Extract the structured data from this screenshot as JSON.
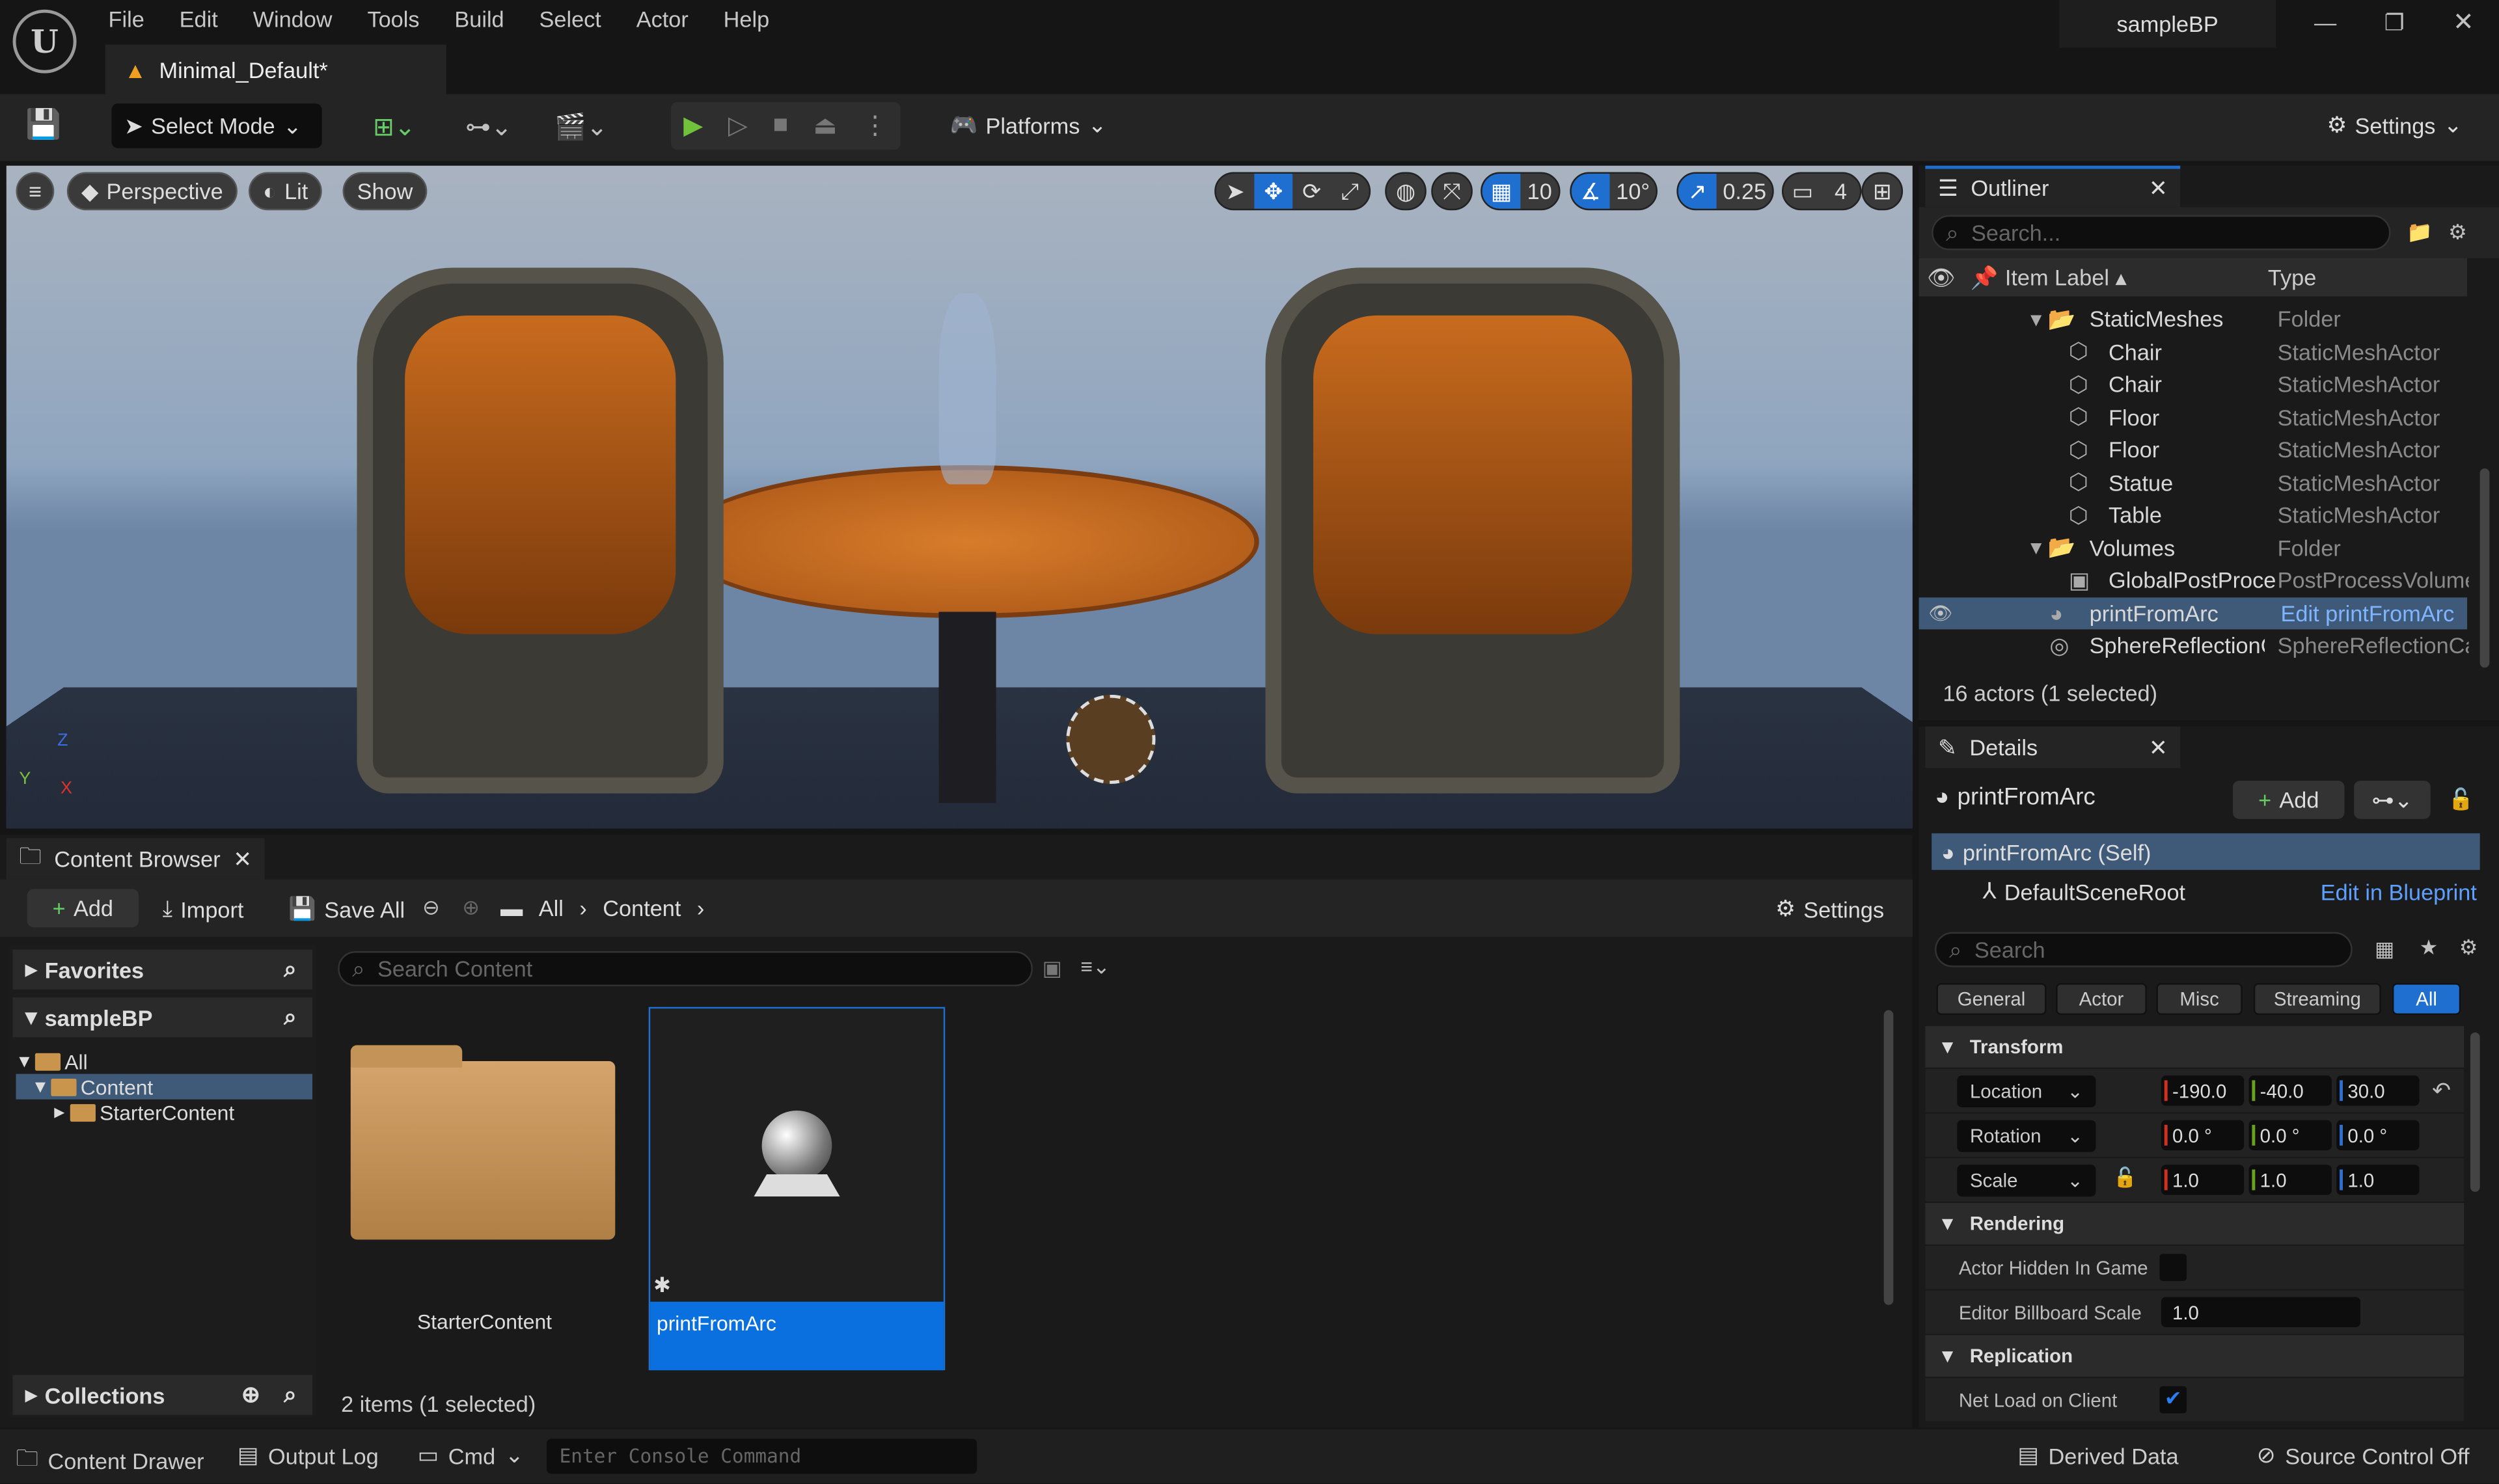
{
  "menu": [
    "File",
    "Edit",
    "Window",
    "Tools",
    "Build",
    "Select",
    "Actor",
    "Help"
  ],
  "project": "sampleBP",
  "level_tab": "Minimal_Default*",
  "toolbar": {
    "select_mode": "Select Mode",
    "platforms": "Platforms",
    "settings": "Settings"
  },
  "viewport": {
    "perspective": "Perspective",
    "lit": "Lit",
    "show": "Show",
    "grid_snap": "10",
    "rot_snap": "10°",
    "scale_snap": "0.25",
    "camera_speed": "4",
    "active_tool": "translate",
    "axes": [
      "Z",
      "Y",
      "X"
    ]
  },
  "outliner": {
    "title": "Outliner",
    "search_placeholder": "Search...",
    "col_label": "Item Label",
    "col_type": "Type",
    "rows": [
      {
        "label": "StaticMeshes",
        "type": "Folder",
        "icon": "folder-icon",
        "indent": 0
      },
      {
        "label": "Chair",
        "type": "StaticMeshActor",
        "icon": "static-mesh-icon",
        "indent": 1
      },
      {
        "label": "Chair",
        "type": "StaticMeshActor",
        "icon": "static-mesh-icon",
        "indent": 1
      },
      {
        "label": "Floor",
        "type": "StaticMeshActor",
        "icon": "static-mesh-icon",
        "indent": 1
      },
      {
        "label": "Floor",
        "type": "StaticMeshActor",
        "icon": "static-mesh-icon",
        "indent": 1
      },
      {
        "label": "Statue",
        "type": "StaticMeshActor",
        "icon": "static-mesh-icon",
        "indent": 1
      },
      {
        "label": "Table",
        "type": "StaticMeshActor",
        "icon": "static-mesh-icon",
        "indent": 1
      },
      {
        "label": "Volumes",
        "type": "Folder",
        "icon": "folder-icon",
        "indent": 0
      },
      {
        "label": "GlobalPostProce",
        "type": "PostProcessVolume",
        "icon": "post-process-icon",
        "indent": 1
      },
      {
        "label": "printFromArc",
        "type": "Edit printFromArc",
        "icon": "actor-icon",
        "indent": 0,
        "selected": true
      },
      {
        "label": "SphereReflectionC",
        "type": "SphereReflectionCa",
        "icon": "sphere-reflection-icon",
        "indent": 0
      }
    ],
    "status": "16 actors (1 selected)"
  },
  "details": {
    "title": "Details",
    "actor": "printFromArc",
    "add": "Add",
    "self": "printFromArc (Self)",
    "root": "DefaultSceneRoot",
    "edit_bp": "Edit in Blueprint",
    "search_placeholder": "Search",
    "filters": [
      "General",
      "Actor",
      "Misc",
      "Streaming",
      "All"
    ],
    "active_filter": "All",
    "transform": {
      "title": "Transform",
      "location_label": "Location",
      "rotation_label": "Rotation",
      "scale_label": "Scale",
      "location": [
        "-190.0",
        "-40.0",
        "30.0"
      ],
      "rotation": [
        "0.0 °",
        "0.0 °",
        "0.0 °"
      ],
      "scale": [
        "1.0",
        "1.0",
        "1.0"
      ]
    },
    "rendering": {
      "title": "Rendering",
      "hidden_label": "Actor Hidden In Game",
      "hidden": false,
      "billboard_label": "Editor Billboard Scale",
      "billboard": "1.0"
    },
    "replication": {
      "title": "Replication",
      "net_load_label": "Net Load on Client",
      "net_load": true
    }
  },
  "content_browser": {
    "title": "Content Browser",
    "add": "Add",
    "import": "Import",
    "save_all": "Save All",
    "path": [
      "All",
      "Content"
    ],
    "settings": "Settings",
    "favorites": "Favorites",
    "project": "sampleBP",
    "tree": [
      "All",
      "Content",
      "StarterContent"
    ],
    "collections": "Collections",
    "search_placeholder": "Search Content",
    "assets": [
      {
        "name": "StarterContent",
        "kind": "folder"
      },
      {
        "name": "printFromArc",
        "kind": "blueprint",
        "selected": true
      }
    ],
    "status": "2 items (1 selected)"
  },
  "statusbar": {
    "content_drawer": "Content Drawer",
    "output_log": "Output Log",
    "cmd": "Cmd",
    "console_placeholder": "Enter Console Command",
    "derived_data": "Derived Data",
    "source_control": "Source Control Off"
  },
  "colors": {
    "accent": "#1f6fd1",
    "selection": "#3f5a78",
    "x": "#d03020",
    "y": "#6aa020",
    "z": "#2f6fd0"
  }
}
